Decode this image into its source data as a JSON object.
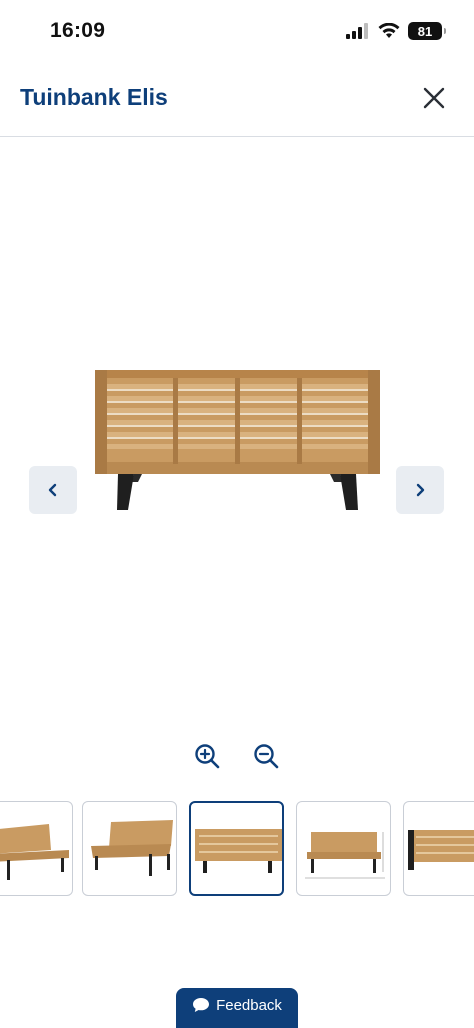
{
  "status_bar": {
    "time": "16:09",
    "battery": "81"
  },
  "header": {
    "title": "Tuinbank Elis"
  },
  "gallery": {
    "current_image_alt": "Tuinbank Elis achterkant",
    "thumbnails_count_visible": 5,
    "selected_index": 2
  },
  "feedback": {
    "label": "Feedback"
  },
  "colors": {
    "brand": "#0e3f7a",
    "wood": "#c99b62",
    "nav_bg": "#e9edf2"
  }
}
